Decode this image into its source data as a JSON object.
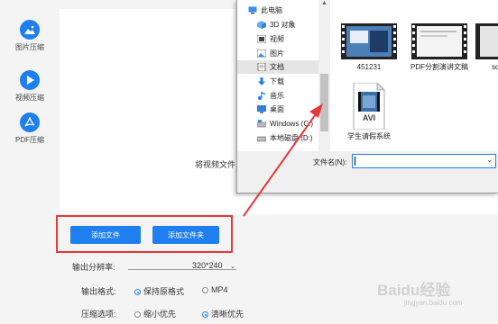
{
  "sidebar": {
    "items": [
      {
        "label": "图片压缩",
        "icon": "image-icon"
      },
      {
        "label": "视频压缩",
        "icon": "play-icon"
      },
      {
        "label": "PDF压缩",
        "icon": "pdf-icon"
      }
    ]
  },
  "main": {
    "drop_hint": "将视频文件",
    "add_file_button": "添加文件",
    "add_folder_button": "添加文件夹",
    "resolution_label": "输出分辨率:",
    "resolution_value": "320*240",
    "format_label": "输出格式:",
    "format_options": [
      "保持原格式",
      "MP4"
    ],
    "compress_label": "压缩选项:",
    "compress_options": [
      "缩小优先",
      "清晰优先"
    ]
  },
  "dialog": {
    "tree": [
      {
        "label": "此电脑",
        "icon": "computer-icon"
      },
      {
        "label": "3D 对象",
        "icon": "cube-icon"
      },
      {
        "label": "视频",
        "icon": "video-folder-icon"
      },
      {
        "label": "图片",
        "icon": "picture-folder-icon"
      },
      {
        "label": "文档",
        "icon": "document-folder-icon",
        "selected": true
      },
      {
        "label": "下载",
        "icon": "download-icon"
      },
      {
        "label": "音乐",
        "icon": "music-icon"
      },
      {
        "label": "桌面",
        "icon": "desktop-icon"
      },
      {
        "label": "Windows (C:)",
        "icon": "drive-icon"
      },
      {
        "label": "本地磁盘 (D:)",
        "icon": "drive-icon"
      }
    ],
    "files": [
      {
        "name": "451231",
        "icon": "video-thumbnail-icon"
      },
      {
        "name": "PDF分割演讲文稿",
        "icon": "video-thumbnail-icon"
      },
      {
        "name": "sdg",
        "icon": "video-thumbnail-icon"
      },
      {
        "name": "学生请假系统",
        "icon": "avi-file-icon",
        "badge": "AVI"
      }
    ],
    "filename_label": "文件名(N):",
    "filename_value": ""
  },
  "watermark": {
    "text": "Baidu经验",
    "sub": "jingyan.baidu.com"
  },
  "colors": {
    "accent": "#1f7ef0",
    "highlight": "#e5393a"
  }
}
